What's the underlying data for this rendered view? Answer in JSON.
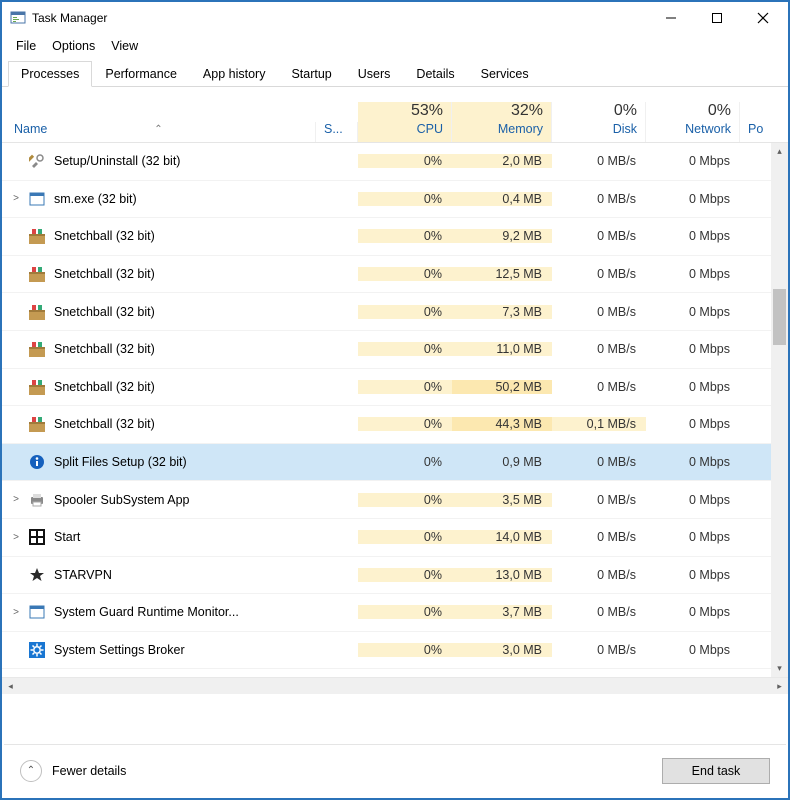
{
  "window": {
    "title": "Task Manager"
  },
  "menu": {
    "file": "File",
    "options": "Options",
    "view": "View"
  },
  "tabs": [
    "Processes",
    "Performance",
    "App history",
    "Startup",
    "Users",
    "Details",
    "Services"
  ],
  "columns": {
    "name": "Name",
    "status": "S...",
    "cpu": {
      "pct": "53%",
      "label": "CPU"
    },
    "memory": {
      "pct": "32%",
      "label": "Memory"
    },
    "disk": {
      "pct": "0%",
      "label": "Disk"
    },
    "network": {
      "pct": "0%",
      "label": "Network"
    },
    "power": {
      "pct": "",
      "label": "Po"
    }
  },
  "rows": [
    {
      "exp": "",
      "icon": "tools",
      "name": "Setup/Uninstall (32 bit)",
      "cpu": "0%",
      "mem": "2,0 MB",
      "disk": "0 MB/s",
      "net": "0 Mbps"
    },
    {
      "exp": ">",
      "icon": "window",
      "name": "sm.exe (32 bit)",
      "cpu": "0%",
      "mem": "0,4 MB",
      "disk": "0 MB/s",
      "net": "0 Mbps"
    },
    {
      "exp": "",
      "icon": "snetch",
      "name": "Snetchball (32 bit)",
      "cpu": "0%",
      "mem": "9,2 MB",
      "disk": "0 MB/s",
      "net": "0 Mbps"
    },
    {
      "exp": "",
      "icon": "snetch",
      "name": "Snetchball (32 bit)",
      "cpu": "0%",
      "mem": "12,5 MB",
      "disk": "0 MB/s",
      "net": "0 Mbps"
    },
    {
      "exp": "",
      "icon": "snetch",
      "name": "Snetchball (32 bit)",
      "cpu": "0%",
      "mem": "7,3 MB",
      "disk": "0 MB/s",
      "net": "0 Mbps"
    },
    {
      "exp": "",
      "icon": "snetch",
      "name": "Snetchball (32 bit)",
      "cpu": "0%",
      "mem": "11,0 MB",
      "disk": "0 MB/s",
      "net": "0 Mbps"
    },
    {
      "exp": "",
      "icon": "snetch",
      "name": "Snetchball (32 bit)",
      "cpu": "0%",
      "mem": "50,2 MB",
      "disk": "0 MB/s",
      "net": "0 Mbps"
    },
    {
      "exp": "",
      "icon": "snetch",
      "name": "Snetchball (32 bit)",
      "cpu": "0%",
      "mem": "44,3 MB",
      "disk": "0,1 MB/s",
      "net": "0 Mbps"
    },
    {
      "exp": "",
      "icon": "info",
      "name": "Split Files Setup (32 bit)",
      "cpu": "0%",
      "mem": "0,9 MB",
      "disk": "0 MB/s",
      "net": "0 Mbps",
      "selected": true
    },
    {
      "exp": ">",
      "icon": "printer",
      "name": "Spooler SubSystem App",
      "cpu": "0%",
      "mem": "3,5 MB",
      "disk": "0 MB/s",
      "net": "0 Mbps"
    },
    {
      "exp": ">",
      "icon": "start",
      "name": "Start",
      "cpu": "0%",
      "mem": "14,0 MB",
      "disk": "0 MB/s",
      "net": "0 Mbps"
    },
    {
      "exp": "",
      "icon": "star",
      "name": "STARVPN",
      "cpu": "0%",
      "mem": "13,0 MB",
      "disk": "0 MB/s",
      "net": "0 Mbps"
    },
    {
      "exp": ">",
      "icon": "window",
      "name": "System Guard Runtime Monitor...",
      "cpu": "0%",
      "mem": "3,7 MB",
      "disk": "0 MB/s",
      "net": "0 Mbps"
    },
    {
      "exp": "",
      "icon": "gear",
      "name": "System Settings Broker",
      "cpu": "0%",
      "mem": "3,0 MB",
      "disk": "0 MB/s",
      "net": "0 Mbps"
    }
  ],
  "footer": {
    "fewer": "Fewer details",
    "end": "End task"
  }
}
